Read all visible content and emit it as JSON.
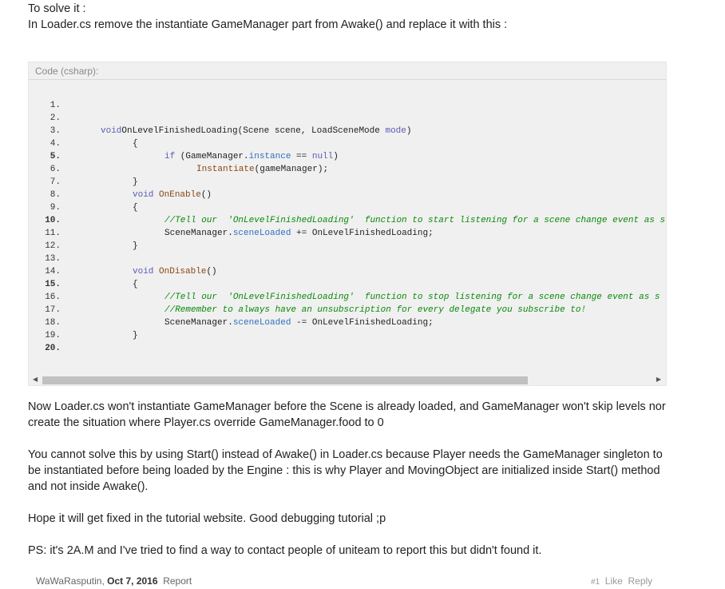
{
  "intro": {
    "line1": "To solve it :",
    "line2": "In Loader.cs remove the instantiate GameManager part from Awake() and replace it with this :"
  },
  "code": {
    "header": "Code (csharp):",
    "lines": [
      {
        "n": "1.",
        "bold": false,
        "indent": 0,
        "parts": []
      },
      {
        "n": "2.",
        "bold": false,
        "indent": 0,
        "parts": []
      },
      {
        "n": "3.",
        "bold": false,
        "indent": 1,
        "parts": [
          [
            "kw",
            "void"
          ],
          [
            "",
            "OnLevelFinishedLoading(Scene scene, LoadSceneMode "
          ],
          [
            "kw",
            "mode"
          ],
          [
            "",
            ")"
          ]
        ]
      },
      {
        "n": "4.",
        "bold": false,
        "indent": 2,
        "parts": [
          [
            "",
            "{"
          ]
        ]
      },
      {
        "n": "5.",
        "bold": true,
        "indent": 3,
        "parts": [
          [
            "kw",
            "if"
          ],
          [
            "",
            " (GameManager."
          ],
          [
            "pr",
            "instance"
          ],
          [
            "",
            " == "
          ],
          [
            "kw",
            "null"
          ],
          [
            "",
            ")"
          ]
        ]
      },
      {
        "n": "6.",
        "bold": false,
        "indent": 4,
        "parts": [
          [
            "fn",
            "Instantiate"
          ],
          [
            "",
            "(gameManager);"
          ]
        ]
      },
      {
        "n": "7.",
        "bold": false,
        "indent": 2,
        "parts": [
          [
            "",
            "}"
          ]
        ]
      },
      {
        "n": "8.",
        "bold": false,
        "indent": 2,
        "parts": [
          [
            "kw",
            "void"
          ],
          [
            "",
            " "
          ],
          [
            "fn",
            "OnEnable"
          ],
          [
            "",
            "()"
          ]
        ]
      },
      {
        "n": "9.",
        "bold": false,
        "indent": 2,
        "parts": [
          [
            "",
            "{"
          ]
        ]
      },
      {
        "n": "10.",
        "bold": true,
        "indent": 3,
        "parts": [
          [
            "cm",
            "//Tell our  'OnLevelFinishedLoading'  function to start listening for a scene change event as s"
          ]
        ]
      },
      {
        "n": "11.",
        "bold": false,
        "indent": 3,
        "parts": [
          [
            "",
            "SceneManager."
          ],
          [
            "pr",
            "sceneLoaded"
          ],
          [
            "",
            " += OnLevelFinishedLoading;"
          ]
        ]
      },
      {
        "n": "12.",
        "bold": false,
        "indent": 2,
        "parts": [
          [
            "",
            "}"
          ]
        ]
      },
      {
        "n": "13.",
        "bold": false,
        "indent": 0,
        "parts": []
      },
      {
        "n": "14.",
        "bold": false,
        "indent": 2,
        "parts": [
          [
            "kw",
            "void"
          ],
          [
            "",
            " "
          ],
          [
            "fn",
            "OnDisable"
          ],
          [
            "",
            "()"
          ]
        ]
      },
      {
        "n": "15.",
        "bold": true,
        "indent": 2,
        "parts": [
          [
            "",
            "{"
          ]
        ]
      },
      {
        "n": "16.",
        "bold": false,
        "indent": 3,
        "parts": [
          [
            "cm",
            "//Tell our  'OnLevelFinishedLoading'  function to stop listening for a scene change event as s"
          ]
        ]
      },
      {
        "n": "17.",
        "bold": false,
        "indent": 3,
        "parts": [
          [
            "cm",
            "//Remember to always have an unsubscription for every delegate you subscribe to!"
          ]
        ]
      },
      {
        "n": "18.",
        "bold": false,
        "indent": 3,
        "parts": [
          [
            "",
            "SceneManager."
          ],
          [
            "pr",
            "sceneLoaded"
          ],
          [
            "",
            " -= OnLevelFinishedLoading;"
          ]
        ]
      },
      {
        "n": "19.",
        "bold": false,
        "indent": 2,
        "parts": [
          [
            "",
            "}"
          ]
        ]
      },
      {
        "n": "20.",
        "bold": true,
        "indent": 0,
        "parts": []
      }
    ]
  },
  "paragraphs": [
    "Now Loader.cs won't instantiate GameManager before the Scene is already loaded, and GameManager won't skip levels nor create the situation where Player.cs override GameManager.food to 0",
    "You cannot solve this by using Start() instead of Awake() in Loader.cs because Player needs the GameManager singleton to be instantiated before being loaded by the Engine : this is why Player and MovingObject are initialized inside Start() method and not inside Awake().",
    "Hope it will get fixed in the tutorial website. Good debugging tutorial ;p",
    "PS: it's 2A.M and I've tried to find a way to contact people of uniteam to report this but didn't found it."
  ],
  "footer": {
    "author": "WaWaRasputin",
    "date": "Oct 7, 2016",
    "report": "Report",
    "post_num": "#1",
    "like": "Like",
    "reply": "Reply"
  }
}
